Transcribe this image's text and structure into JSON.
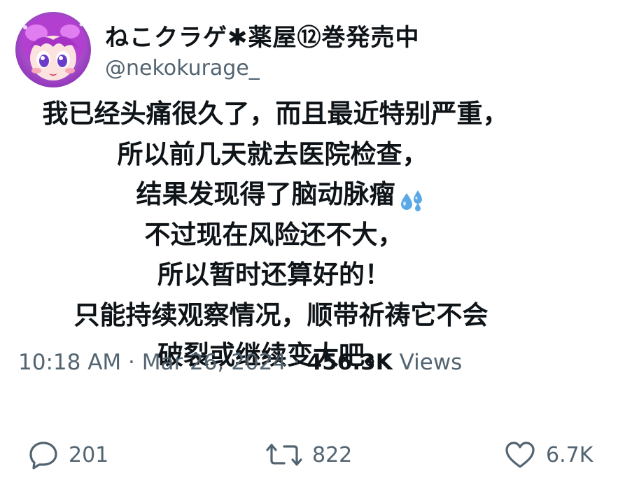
{
  "author": {
    "display_name": "ねこクラゲ✱薬屋⑫巻発売中",
    "handle": "@nekokurage_",
    "avatar_icon": "anime-girl-avatar"
  },
  "tweet": {
    "lines": [
      "我已经头痛很久了，而且最近特别严重，",
      "所以前几天就去医院检查，",
      "结果发现得了脑动脉瘤",
      "不过现在风险还不大，",
      "所以暂时还算好的！",
      "只能持续观察情况，顺带祈祷它不会",
      "破裂或继续变大吧。"
    ],
    "emoji": "sweat-droplets-icon"
  },
  "meta": {
    "time": "10:18 AM",
    "separator": " · ",
    "date": "Mar 26, 2024",
    "views_count": "456.3K",
    "views_label": " Views"
  },
  "actions": {
    "replies": "201",
    "retweets": "822",
    "likes": "6.7K"
  },
  "colors": {
    "text": "#0f1419",
    "secondary": "#536471",
    "emoji_blue": "#5aa9e6"
  }
}
